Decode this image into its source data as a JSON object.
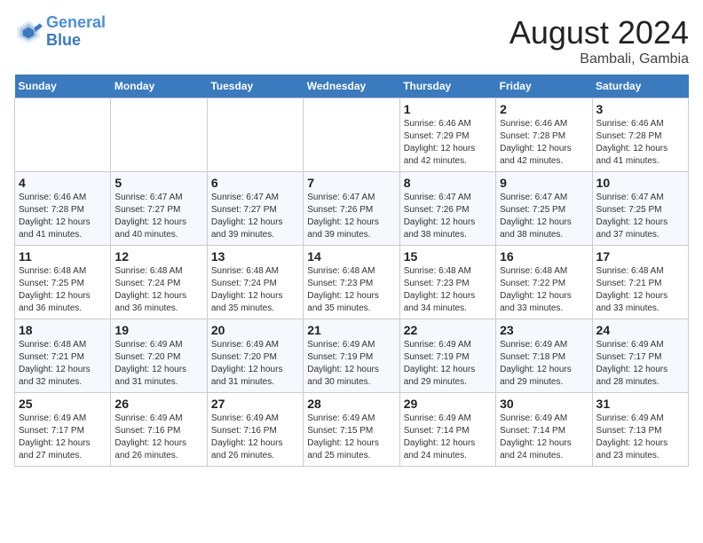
{
  "header": {
    "logo_line1": "General",
    "logo_line2": "Blue",
    "title": "August 2024",
    "subtitle": "Bambali, Gambia"
  },
  "weekdays": [
    "Sunday",
    "Monday",
    "Tuesday",
    "Wednesday",
    "Thursday",
    "Friday",
    "Saturday"
  ],
  "weeks": [
    [
      {
        "day": "",
        "info": ""
      },
      {
        "day": "",
        "info": ""
      },
      {
        "day": "",
        "info": ""
      },
      {
        "day": "",
        "info": ""
      },
      {
        "day": "1",
        "info": "Sunrise: 6:46 AM\nSunset: 7:29 PM\nDaylight: 12 hours\nand 42 minutes."
      },
      {
        "day": "2",
        "info": "Sunrise: 6:46 AM\nSunset: 7:28 PM\nDaylight: 12 hours\nand 42 minutes."
      },
      {
        "day": "3",
        "info": "Sunrise: 6:46 AM\nSunset: 7:28 PM\nDaylight: 12 hours\nand 41 minutes."
      }
    ],
    [
      {
        "day": "4",
        "info": "Sunrise: 6:46 AM\nSunset: 7:28 PM\nDaylight: 12 hours\nand 41 minutes."
      },
      {
        "day": "5",
        "info": "Sunrise: 6:47 AM\nSunset: 7:27 PM\nDaylight: 12 hours\nand 40 minutes."
      },
      {
        "day": "6",
        "info": "Sunrise: 6:47 AM\nSunset: 7:27 PM\nDaylight: 12 hours\nand 39 minutes."
      },
      {
        "day": "7",
        "info": "Sunrise: 6:47 AM\nSunset: 7:26 PM\nDaylight: 12 hours\nand 39 minutes."
      },
      {
        "day": "8",
        "info": "Sunrise: 6:47 AM\nSunset: 7:26 PM\nDaylight: 12 hours\nand 38 minutes."
      },
      {
        "day": "9",
        "info": "Sunrise: 6:47 AM\nSunset: 7:25 PM\nDaylight: 12 hours\nand 38 minutes."
      },
      {
        "day": "10",
        "info": "Sunrise: 6:47 AM\nSunset: 7:25 PM\nDaylight: 12 hours\nand 37 minutes."
      }
    ],
    [
      {
        "day": "11",
        "info": "Sunrise: 6:48 AM\nSunset: 7:25 PM\nDaylight: 12 hours\nand 36 minutes."
      },
      {
        "day": "12",
        "info": "Sunrise: 6:48 AM\nSunset: 7:24 PM\nDaylight: 12 hours\nand 36 minutes."
      },
      {
        "day": "13",
        "info": "Sunrise: 6:48 AM\nSunset: 7:24 PM\nDaylight: 12 hours\nand 35 minutes."
      },
      {
        "day": "14",
        "info": "Sunrise: 6:48 AM\nSunset: 7:23 PM\nDaylight: 12 hours\nand 35 minutes."
      },
      {
        "day": "15",
        "info": "Sunrise: 6:48 AM\nSunset: 7:23 PM\nDaylight: 12 hours\nand 34 minutes."
      },
      {
        "day": "16",
        "info": "Sunrise: 6:48 AM\nSunset: 7:22 PM\nDaylight: 12 hours\nand 33 minutes."
      },
      {
        "day": "17",
        "info": "Sunrise: 6:48 AM\nSunset: 7:21 PM\nDaylight: 12 hours\nand 33 minutes."
      }
    ],
    [
      {
        "day": "18",
        "info": "Sunrise: 6:48 AM\nSunset: 7:21 PM\nDaylight: 12 hours\nand 32 minutes."
      },
      {
        "day": "19",
        "info": "Sunrise: 6:49 AM\nSunset: 7:20 PM\nDaylight: 12 hours\nand 31 minutes."
      },
      {
        "day": "20",
        "info": "Sunrise: 6:49 AM\nSunset: 7:20 PM\nDaylight: 12 hours\nand 31 minutes."
      },
      {
        "day": "21",
        "info": "Sunrise: 6:49 AM\nSunset: 7:19 PM\nDaylight: 12 hours\nand 30 minutes."
      },
      {
        "day": "22",
        "info": "Sunrise: 6:49 AM\nSunset: 7:19 PM\nDaylight: 12 hours\nand 29 minutes."
      },
      {
        "day": "23",
        "info": "Sunrise: 6:49 AM\nSunset: 7:18 PM\nDaylight: 12 hours\nand 29 minutes."
      },
      {
        "day": "24",
        "info": "Sunrise: 6:49 AM\nSunset: 7:17 PM\nDaylight: 12 hours\nand 28 minutes."
      }
    ],
    [
      {
        "day": "25",
        "info": "Sunrise: 6:49 AM\nSunset: 7:17 PM\nDaylight: 12 hours\nand 27 minutes."
      },
      {
        "day": "26",
        "info": "Sunrise: 6:49 AM\nSunset: 7:16 PM\nDaylight: 12 hours\nand 26 minutes."
      },
      {
        "day": "27",
        "info": "Sunrise: 6:49 AM\nSunset: 7:16 PM\nDaylight: 12 hours\nand 26 minutes."
      },
      {
        "day": "28",
        "info": "Sunrise: 6:49 AM\nSunset: 7:15 PM\nDaylight: 12 hours\nand 25 minutes."
      },
      {
        "day": "29",
        "info": "Sunrise: 6:49 AM\nSunset: 7:14 PM\nDaylight: 12 hours\nand 24 minutes."
      },
      {
        "day": "30",
        "info": "Sunrise: 6:49 AM\nSunset: 7:14 PM\nDaylight: 12 hours\nand 24 minutes."
      },
      {
        "day": "31",
        "info": "Sunrise: 6:49 AM\nSunset: 7:13 PM\nDaylight: 12 hours\nand 23 minutes."
      }
    ]
  ]
}
